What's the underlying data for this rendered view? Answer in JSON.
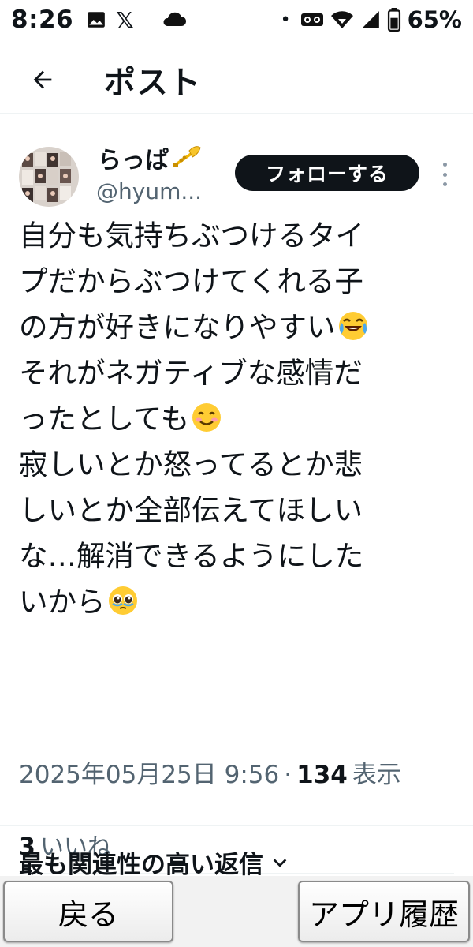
{
  "status_bar": {
    "time": "8:26",
    "x_logo": "𝕏",
    "battery_percent": "65%",
    "left_icons": [
      "image-icon",
      "x-logo-icon",
      "cloud-icon",
      "dot-icon"
    ],
    "right_icons": [
      "voicemail-icon",
      "wifi-icon",
      "signal-icon",
      "battery-icon"
    ]
  },
  "header": {
    "title": "ポスト",
    "back_icon": "arrow-left-icon"
  },
  "post": {
    "author": {
      "display_name": "らっぱ",
      "name_emoji": "trumpet",
      "handle": "@hyum..."
    },
    "follow_label": "フォローする",
    "text_lines": [
      "自分も気持ちぶつけるタイ",
      "プだからぶつけてくれる子",
      "の方が好きになりやすい",
      "それがネガティブな感情だ",
      "ったとしても",
      "寂しいとか怒ってるとか悲",
      "しいとか全部伝えてほしい",
      "な…解消できるようにした",
      "いから"
    ],
    "emojis": [
      "joy",
      "smiling",
      "pleading"
    ],
    "date": "2025年05月25日 9:56",
    "separator": "·",
    "views_count": "134",
    "views_label": "表示",
    "likes_count": "3",
    "likes_label": "いいね"
  },
  "actions": [
    "reply-icon",
    "repost-icon",
    "like-icon",
    "bookmark-icon",
    "share-icon"
  ],
  "replies_sort": {
    "label": "最も関連性の高い返信",
    "icon": "chevron-down-icon"
  },
  "system_nav": {
    "back_label": "戻る",
    "history_label": "アプリ履歴"
  },
  "colors": {
    "text": "#0f1419",
    "muted": "#536471",
    "icon": "#8b98a5",
    "follow_bg": "#0f1419",
    "divider": "#eff3f4"
  }
}
